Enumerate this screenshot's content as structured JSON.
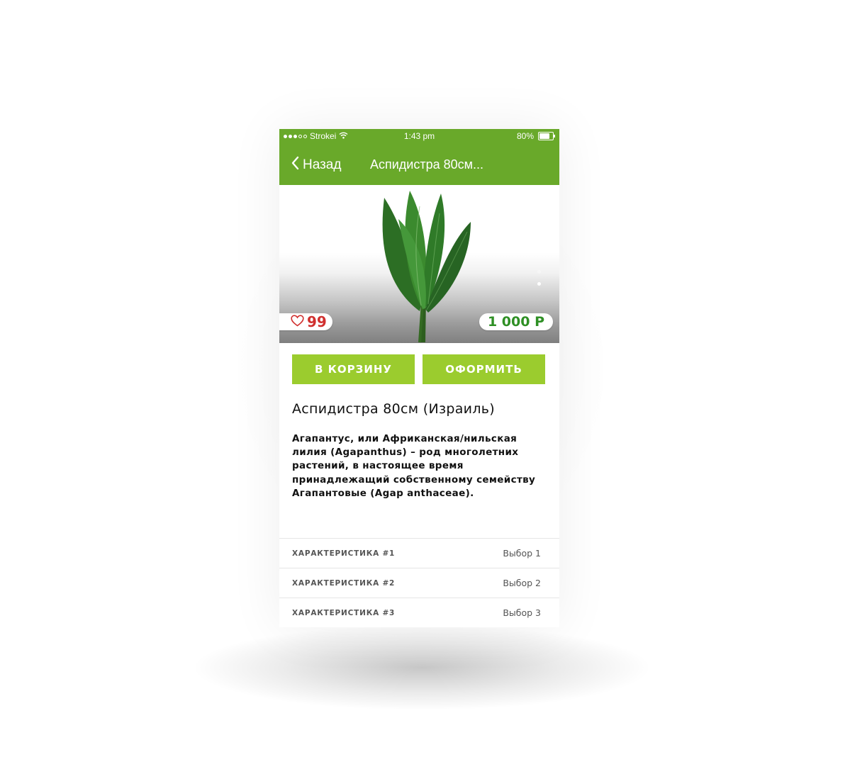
{
  "status_bar": {
    "carrier": "Strokei",
    "time": "1:43 pm",
    "battery": "80%",
    "battery_level": 0.8
  },
  "nav": {
    "back_label": "Назад",
    "title": "Аспидистра 80см..."
  },
  "hero": {
    "likes": "99",
    "price": "1 000 Р",
    "pager_count": 2,
    "pager_active": 1
  },
  "actions": {
    "cart_label": "В КОРЗИНУ",
    "order_label": "ОФОРМИТЬ"
  },
  "product": {
    "title": "Аспидистра 80см (Израиль)",
    "description": "Агапантус, или Африканская/нильская лилия (Agapanthus) – род многолетних растений, в настоящее время принадлежащий собственному семейству Агапантовые (Agap anthaceae)."
  },
  "specs": [
    {
      "name": "ХАРАКТЕРИСТИКА #1",
      "value": "Выбор 1"
    },
    {
      "name": "ХАРАКТЕРИСТИКА #2",
      "value": "Выбор 2"
    },
    {
      "name": "ХАРАКТЕРИСТИКА #3",
      "value": "Выбор 3"
    }
  ],
  "colors": {
    "header_green": "#69a92a",
    "button_green": "#9bcc2e",
    "price_green": "#2e8f24",
    "likes_red": "#d0302f"
  }
}
